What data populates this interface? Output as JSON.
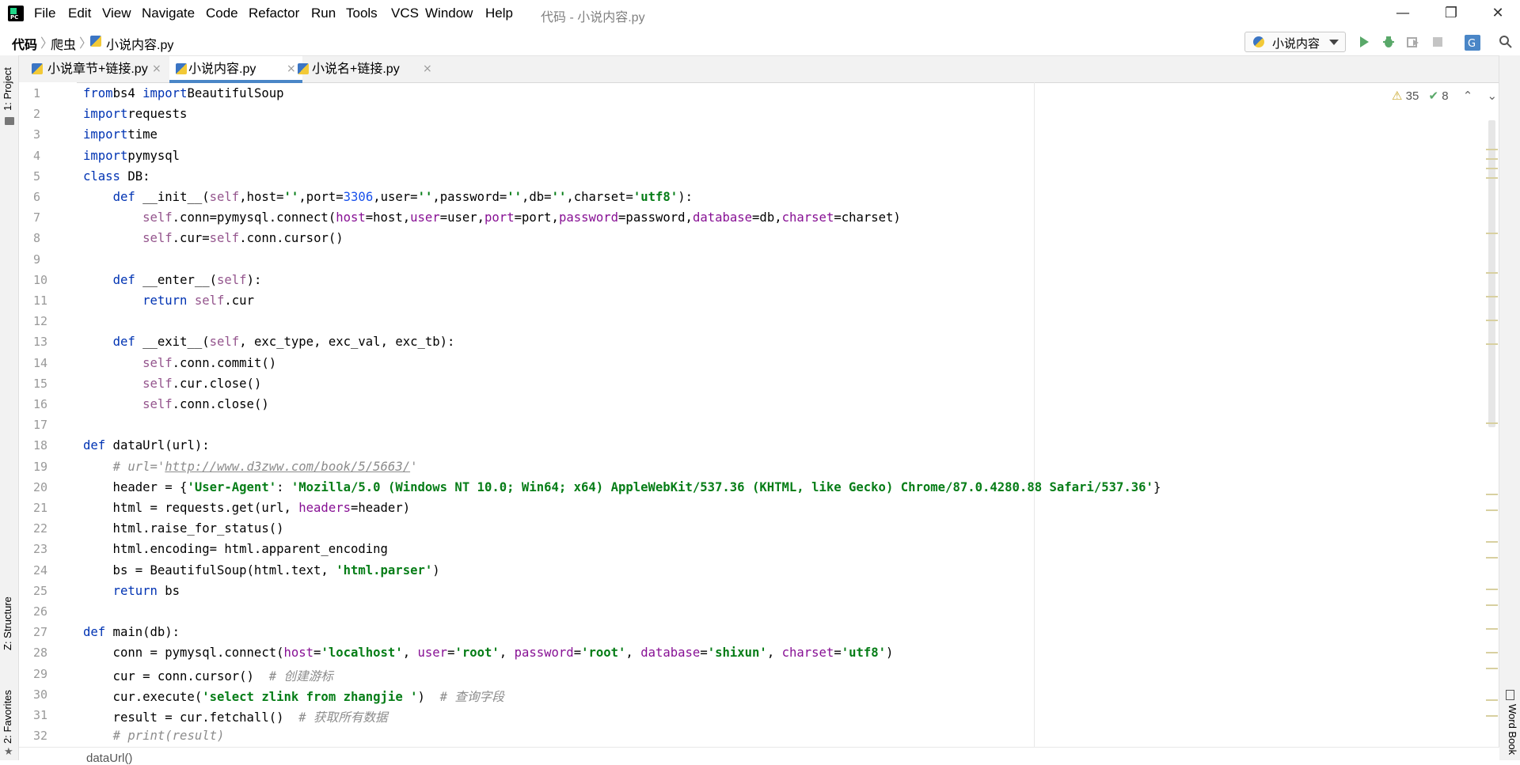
{
  "app": {
    "logo_text": "PC",
    "window_title": "代码 - 小说内容.py"
  },
  "menu": [
    "File",
    "Edit",
    "View",
    "Navigate",
    "Code",
    "Refactor",
    "Run",
    "Tools",
    "VCS",
    "Window",
    "Help"
  ],
  "window_controls": {
    "minimize": "—",
    "restore": "❐",
    "close": "✕"
  },
  "breadcrumb": [
    "代码",
    "爬虫",
    "小说内容.py"
  ],
  "run_config": {
    "label": "小说内容"
  },
  "left_tools": [
    "1: Project",
    "Z: Structure",
    "2: Favorites"
  ],
  "right_tools": [
    "Word Book"
  ],
  "tabs": [
    {
      "label": "小说章节+链接.py",
      "active": false
    },
    {
      "label": "小说内容.py",
      "active": true
    },
    {
      "label": "小说名+链接.py",
      "active": false
    }
  ],
  "inspection": {
    "warnings": "35",
    "typos": "8"
  },
  "line_numbers": [
    "1",
    "2",
    "3",
    "4",
    "5",
    "6",
    "7",
    "8",
    "9",
    "10",
    "11",
    "12",
    "13",
    "14",
    "15",
    "16",
    "17",
    "18",
    "19",
    "20",
    "21",
    "22",
    "23",
    "24",
    "25",
    "26",
    "27",
    "28",
    "29",
    "30",
    "31",
    "32"
  ],
  "code_lines": [
    [
      [
        "kw",
        "from"
      ],
      [
        "",
        "bs4 "
      ],
      [
        "kw",
        "import"
      ],
      [
        "",
        "BeautifulSoup"
      ]
    ],
    [
      [
        "kw",
        "import"
      ],
      [
        "",
        "requests"
      ]
    ],
    [
      [
        "kw",
        "import"
      ],
      [
        "",
        "time"
      ]
    ],
    [
      [
        "kw",
        "import"
      ],
      [
        "",
        "pymysql"
      ]
    ],
    [
      [
        "kw",
        "class"
      ],
      [
        "",
        " DB:"
      ]
    ],
    [
      [
        "",
        "    "
      ],
      [
        "kw",
        "def"
      ],
      [
        "",
        " __init__("
      ],
      [
        "self",
        "self"
      ],
      [
        "",
        ",host="
      ],
      [
        "str",
        "''"
      ],
      [
        "",
        ",port="
      ],
      [
        "num",
        "3306"
      ],
      [
        "",
        ",user="
      ],
      [
        "str",
        "''"
      ],
      [
        "",
        ",password="
      ],
      [
        "str",
        "''"
      ],
      [
        "",
        ",db="
      ],
      [
        "str",
        "''"
      ],
      [
        "",
        ",charset="
      ],
      [
        "str",
        "'utf8'"
      ],
      [
        "",
        "):"
      ]
    ],
    [
      [
        "",
        "        "
      ],
      [
        "self",
        "self"
      ],
      [
        "",
        ".conn=pymysql.connect("
      ],
      [
        "param",
        "host"
      ],
      [
        "",
        "=host,"
      ],
      [
        "param",
        "user"
      ],
      [
        "",
        "=user,"
      ],
      [
        "param",
        "port"
      ],
      [
        "",
        "=port,"
      ],
      [
        "param",
        "password"
      ],
      [
        "",
        "=password,"
      ],
      [
        "param",
        "database"
      ],
      [
        "",
        "=db,"
      ],
      [
        "param",
        "charset"
      ],
      [
        "",
        "=charset)"
      ]
    ],
    [
      [
        "",
        "        "
      ],
      [
        "self",
        "self"
      ],
      [
        "",
        ".cur="
      ],
      [
        "self",
        "self"
      ],
      [
        "",
        ".conn.cursor()"
      ]
    ],
    [
      [
        "",
        ""
      ]
    ],
    [
      [
        "",
        "    "
      ],
      [
        "kw",
        "def"
      ],
      [
        "",
        " __enter__("
      ],
      [
        "self",
        "self"
      ],
      [
        "",
        "):"
      ]
    ],
    [
      [
        "",
        "        "
      ],
      [
        "kw",
        "return"
      ],
      [
        "",
        " "
      ],
      [
        "self",
        "self"
      ],
      [
        "",
        ".cur"
      ]
    ],
    [
      [
        "",
        ""
      ]
    ],
    [
      [
        "",
        "    "
      ],
      [
        "kw",
        "def"
      ],
      [
        "",
        " __exit__("
      ],
      [
        "self",
        "self"
      ],
      [
        "",
        ", exc_type, exc_val, exc_tb):"
      ]
    ],
    [
      [
        "",
        "        "
      ],
      [
        "self",
        "self"
      ],
      [
        "",
        ".conn.commit()"
      ]
    ],
    [
      [
        "",
        "        "
      ],
      [
        "self",
        "self"
      ],
      [
        "",
        ".cur.close()"
      ]
    ],
    [
      [
        "",
        "        "
      ],
      [
        "self",
        "self"
      ],
      [
        "",
        ".conn.close()"
      ]
    ],
    [
      [
        "",
        ""
      ]
    ],
    [
      [
        "kw",
        "def"
      ],
      [
        "",
        " dataUrl(url):"
      ]
    ],
    [
      [
        "",
        "    "
      ],
      [
        "cmt",
        "# url='"
      ],
      [
        "url",
        "http://www.d3zww.com/book/5/5663/"
      ],
      [
        "cmt",
        "'"
      ]
    ],
    [
      [
        "",
        "    header = {"
      ],
      [
        "str",
        "'User-Agent'"
      ],
      [
        "",
        ": "
      ],
      [
        "str",
        "'Mozilla/5.0 (Windows NT 10.0; Win64; x64) AppleWebKit/537.36 (KHTML, like Gecko) Chrome/87.0.4280.88 Safari/537.36'"
      ],
      [
        "",
        "}"
      ]
    ],
    [
      [
        "",
        "    html = requests.get(url, "
      ],
      [
        "param",
        "headers"
      ],
      [
        "",
        "=header)"
      ]
    ],
    [
      [
        "",
        "    html.raise_for_status()"
      ]
    ],
    [
      [
        "",
        "    html.encoding= html.apparent_encoding"
      ]
    ],
    [
      [
        "",
        "    bs = BeautifulSoup(html.text, "
      ],
      [
        "str",
        "'html.parser'"
      ],
      [
        "",
        ")"
      ]
    ],
    [
      [
        "",
        "    "
      ],
      [
        "kw",
        "return"
      ],
      [
        "",
        " bs"
      ]
    ],
    [
      [
        "",
        ""
      ]
    ],
    [
      [
        "kw",
        "def"
      ],
      [
        "",
        " main(db):"
      ]
    ],
    [
      [
        "",
        "    conn = pymysql.connect("
      ],
      [
        "param",
        "host"
      ],
      [
        "",
        "="
      ],
      [
        "str",
        "'localhost'"
      ],
      [
        "",
        ", "
      ],
      [
        "param",
        "user"
      ],
      [
        "",
        "="
      ],
      [
        "str",
        "'root'"
      ],
      [
        "",
        ", "
      ],
      [
        "param",
        "password"
      ],
      [
        "",
        "="
      ],
      [
        "str",
        "'root'"
      ],
      [
        "",
        ", "
      ],
      [
        "param",
        "database"
      ],
      [
        "",
        "="
      ],
      [
        "str",
        "'shixun'"
      ],
      [
        "",
        ", "
      ],
      [
        "param",
        "charset"
      ],
      [
        "",
        "="
      ],
      [
        "str",
        "'utf8'"
      ],
      [
        "",
        ")"
      ]
    ],
    [
      [
        "",
        "    cur = conn.cursor()  "
      ],
      [
        "cmt",
        "# 创建游标"
      ]
    ],
    [
      [
        "",
        "    cur.execute("
      ],
      [
        "str",
        "'select zlink from zhangjie '"
      ],
      [
        "",
        ")  "
      ],
      [
        "cmt",
        "# 查询字段"
      ]
    ],
    [
      [
        "",
        "    result = cur.fetchall()  "
      ],
      [
        "cmt",
        "# 获取所有数据"
      ]
    ],
    [
      [
        "",
        "    "
      ],
      [
        "cmt",
        "# print(result)"
      ]
    ]
  ],
  "bottom_breadcrumb": "dataUrl()"
}
